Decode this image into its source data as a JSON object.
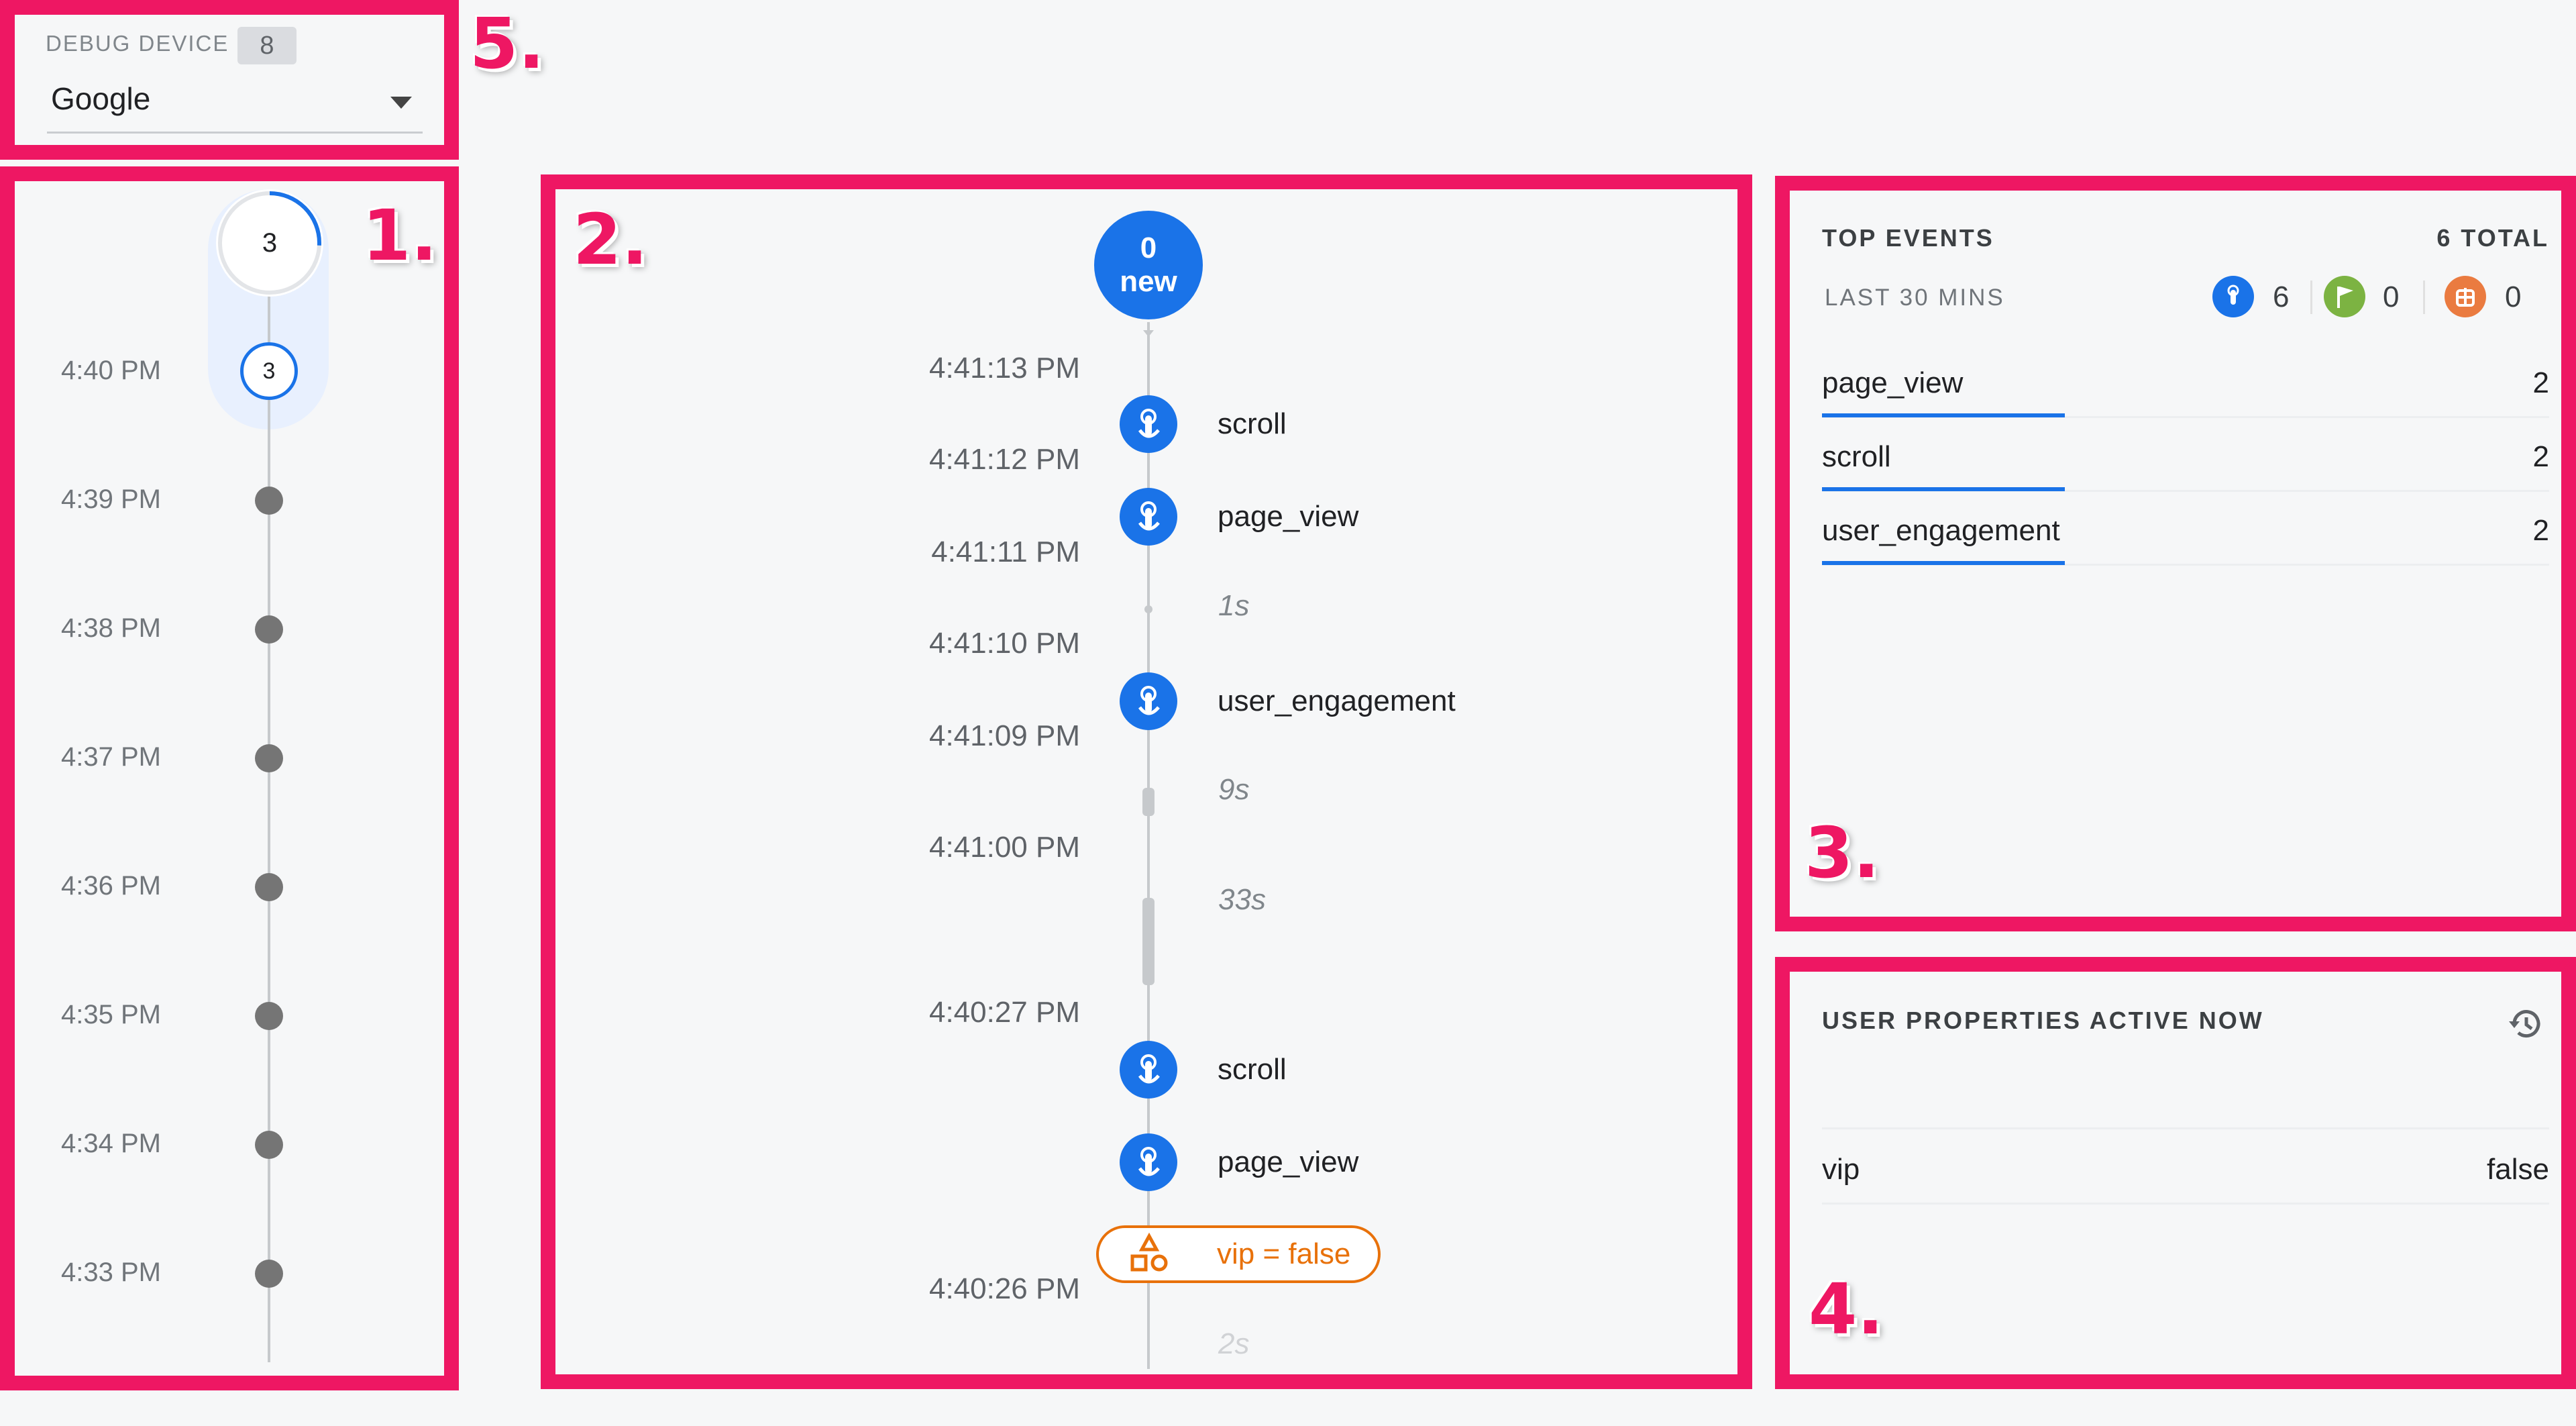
{
  "debug_device": {
    "label": "DEBUG DEVICE",
    "count": "8",
    "selected": "Google"
  },
  "callouts": [
    "1.",
    "2.",
    "3.",
    "4.",
    "5."
  ],
  "minutes": {
    "current_count": "3",
    "current_time": "4:40 PM",
    "current_time_count": "3",
    "rows": [
      "4:39 PM",
      "4:38 PM",
      "4:37 PM",
      "4:36 PM",
      "4:35 PM",
      "4:34 PM",
      "4:33 PM"
    ]
  },
  "stream": {
    "new_count": "0",
    "new_label": "new",
    "times": [
      "4:41:13 PM",
      "4:41:12 PM",
      "4:41:11 PM",
      "4:41:10 PM",
      "4:41:09 PM",
      "4:41:00 PM",
      "4:40:27 PM",
      "4:40:26 PM"
    ],
    "events": [
      "scroll",
      "page_view",
      "user_engagement",
      "scroll",
      "page_view"
    ],
    "gaps": [
      "1s",
      "9s",
      "33s",
      "2s"
    ],
    "user_property": "vip = false"
  },
  "top_events": {
    "title": "TOP EVENTS",
    "total": "6 TOTAL",
    "period": "LAST 30 MINS",
    "counts": {
      "events": "6",
      "conversions": "0",
      "errors": "0"
    },
    "icon_colors": {
      "events": "#1a73e8",
      "conversions": "#7cb342",
      "errors": "#ea7b40"
    },
    "rows": [
      {
        "name": "page_view",
        "value": "2"
      },
      {
        "name": "scroll",
        "value": "2"
      },
      {
        "name": "user_engagement",
        "value": "2"
      }
    ]
  },
  "user_properties": {
    "title": "USER PROPERTIES ACTIVE NOW",
    "rows": [
      {
        "key": "vip",
        "value": "false"
      }
    ]
  },
  "colors": {
    "highlight": "#ee1763",
    "accent": "#1a73e8",
    "property": "#e8710a"
  }
}
